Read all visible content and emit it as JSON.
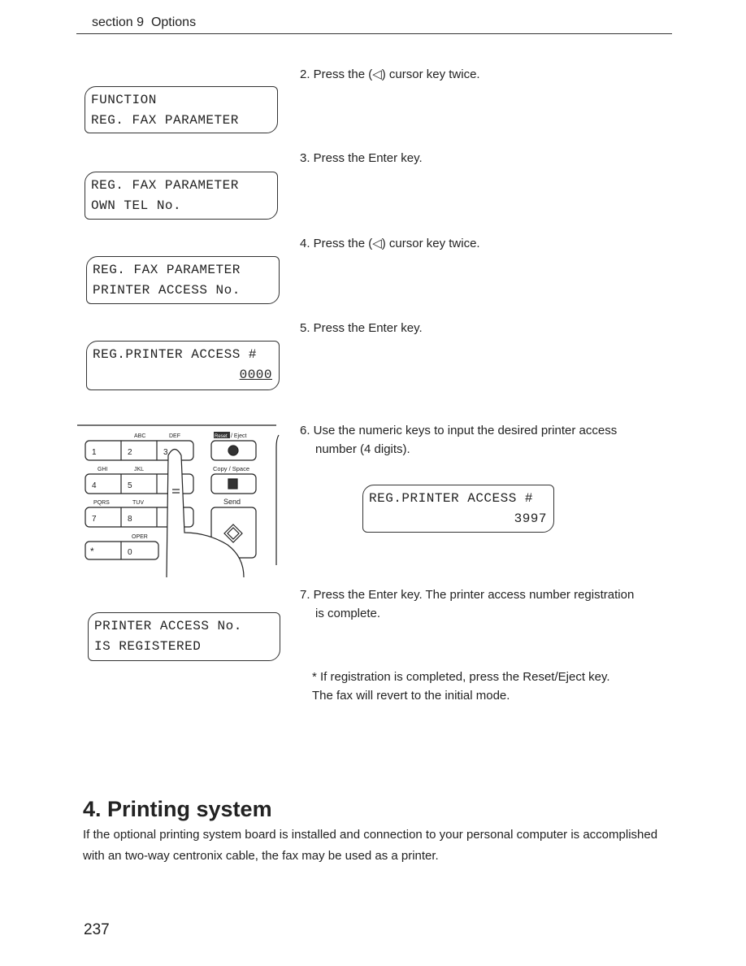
{
  "header": {
    "section": "section 9",
    "title": "Options"
  },
  "steps": [
    "2. Press the (◁) cursor key twice.",
    "3. Press the Enter key.",
    "4. Press the (◁) cursor key twice.",
    "5. Press the Enter key.",
    "6. Use the numeric keys to input the desired printer access",
    "number (4 digits).",
    "7. Press the Enter key. The printer access number registration",
    "is complete."
  ],
  "displays": [
    {
      "line1": "FUNCTION",
      "line2": "REG. FAX PARAMETER"
    },
    {
      "line1": "REG. FAX PARAMETER",
      "line2": "OWN TEL No."
    },
    {
      "line1": "REG. FAX PARAMETER",
      "line2": "PRINTER ACCESS No."
    },
    {
      "line1": "REG.PRINTER ACCESS #",
      "line2": "0000"
    },
    {
      "line1": "REG.PRINTER ACCESS #",
      "line2": "3997"
    },
    {
      "line1": "PRINTER ACCESS No.",
      "line2": "IS REGISTERED"
    }
  ],
  "keypad": {
    "keys": [
      "1",
      "2",
      "3",
      "4",
      "5",
      "7",
      "8",
      "*",
      "0"
    ],
    "letters": [
      "ABC",
      "DEF",
      "GHI",
      "JKL",
      "PQRS",
      "TUV",
      "OPER"
    ],
    "reset": "Reset",
    "eject": "/ Eject",
    "copy": "Copy / Space",
    "send": "Send"
  },
  "note": [
    "* If registration is completed, press the Reset/Eject key.",
    "The fax will revert to the initial mode."
  ],
  "section_heading": "4. Printing system",
  "paragraph": "If the optional printing system board is installed and connection to your personal computer is accomplished with an two-way centronix cable, the fax may be used as a printer.",
  "page_number": "237"
}
